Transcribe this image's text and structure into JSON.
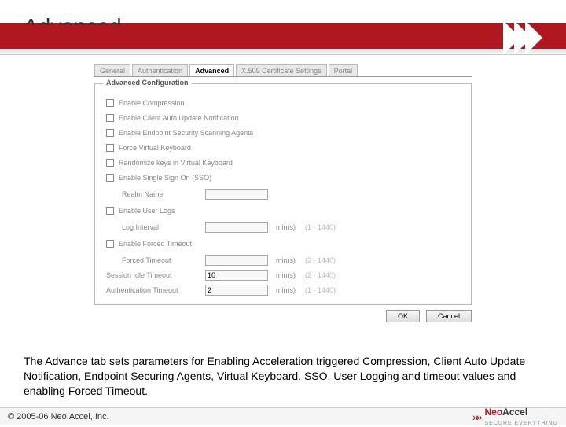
{
  "page": {
    "title": "Advanced"
  },
  "tabs": {
    "items": [
      "General",
      "Authentication",
      "Advanced",
      "X.509 Certificate Settings",
      "Portal"
    ],
    "active": "Advanced"
  },
  "group": {
    "title": "Advanced Configuration",
    "checks": [
      "Enable Compression",
      "Enable Client Auto Update Notification",
      "Enable Endpoint Security Scanning Agents",
      "Force Virtual Keyboard",
      "Randomize keys in Virtual Keyboard",
      "Enable Single Sign On (SSO)"
    ],
    "realm": {
      "label": "Realm Name",
      "value": ""
    },
    "userLogs": {
      "label": "Enable User Logs"
    },
    "logInterval": {
      "label": "Log Interval",
      "value": "",
      "unit": "min(s)",
      "range": "(1 - 1440)"
    },
    "forcedTimeout": {
      "label": "Enable Forced Timeout"
    },
    "forcedTimeoutVal": {
      "label": "Forced Timeout",
      "value": "",
      "unit": "min(s)",
      "range": "(2 - 1440)"
    },
    "idleTimeout": {
      "label": "Session Idle Timeout",
      "value": "10",
      "unit": "min(s)",
      "range": "(2 - 1440)"
    },
    "authTimeout": {
      "label": "Authentication Timeout",
      "value": "2",
      "unit": "min(s)",
      "range": "(1 - 1440)"
    }
  },
  "buttons": {
    "ok": "OK",
    "cancel": "Cancel"
  },
  "description": "The Advance tab sets parameters for Enabling Acceleration triggered Compression, Client Auto Update Notification, Endpoint Securing Agents, Virtual Keyboard, SSO, User Logging and timeout values and enabling Forced Timeout.",
  "footer": {
    "copyright": "© 2005-06 Neo.Accel, Inc.",
    "brand1": "Neo",
    "brand2": "Accel",
    "tagline": "SECURE EVERYTHING"
  }
}
